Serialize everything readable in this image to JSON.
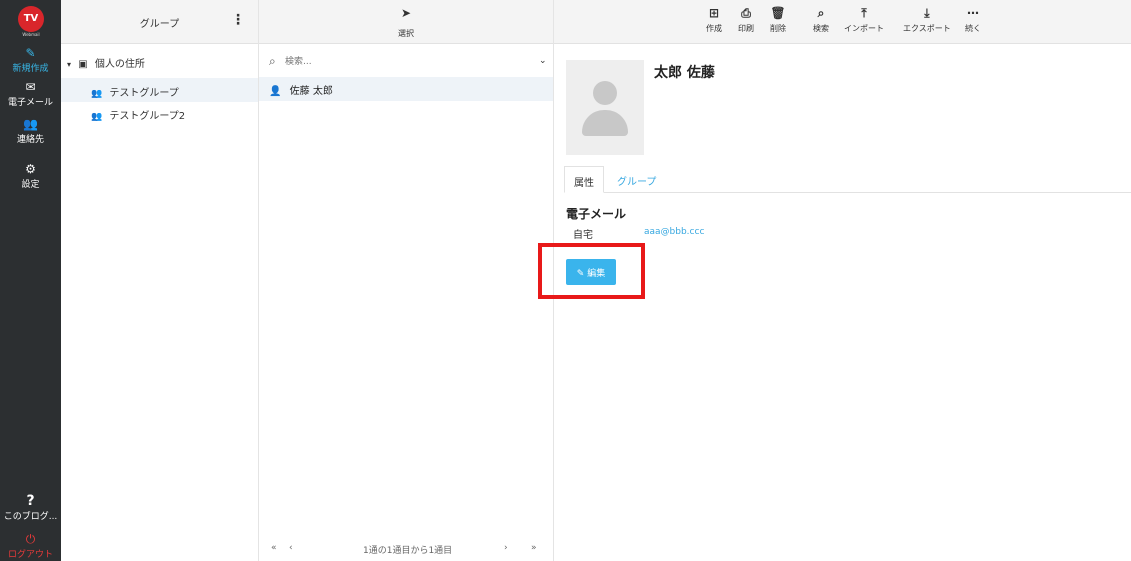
{
  "nav": {
    "logo_text": "TV",
    "logo_caption": "Webmail",
    "compose": "新規作成",
    "email": "電子メール",
    "contacts": "連絡先",
    "settings": "設定",
    "help": "このブログ...",
    "logout": "ログアウト"
  },
  "groups_panel": {
    "title": "グループ",
    "root": "個人の住所",
    "groups": [
      "テストグループ",
      "テストグループ2"
    ]
  },
  "list_panel": {
    "select_label": "選択",
    "search_placeholder": "検索...",
    "contacts": [
      "佐藤 太郎"
    ],
    "pager_text": "1通の1通目から1通目"
  },
  "toolbar": {
    "create": "作成",
    "print": "印刷",
    "delete": "削除",
    "search": "検索",
    "import": "インポート",
    "export": "エクスポート",
    "more": "続く"
  },
  "detail": {
    "name": "太郎 佐藤",
    "tab_properties": "属性",
    "tab_groups": "グループ",
    "section_email": "電子メール",
    "email_label": "自宅",
    "email_value": "aaa@bbb.ccc",
    "edit_button": "編集"
  },
  "colors": {
    "nav_bg": "#2c2f31",
    "accent": "#38a8e0",
    "highlight": "#e81919",
    "logout": "#e53a3a"
  }
}
